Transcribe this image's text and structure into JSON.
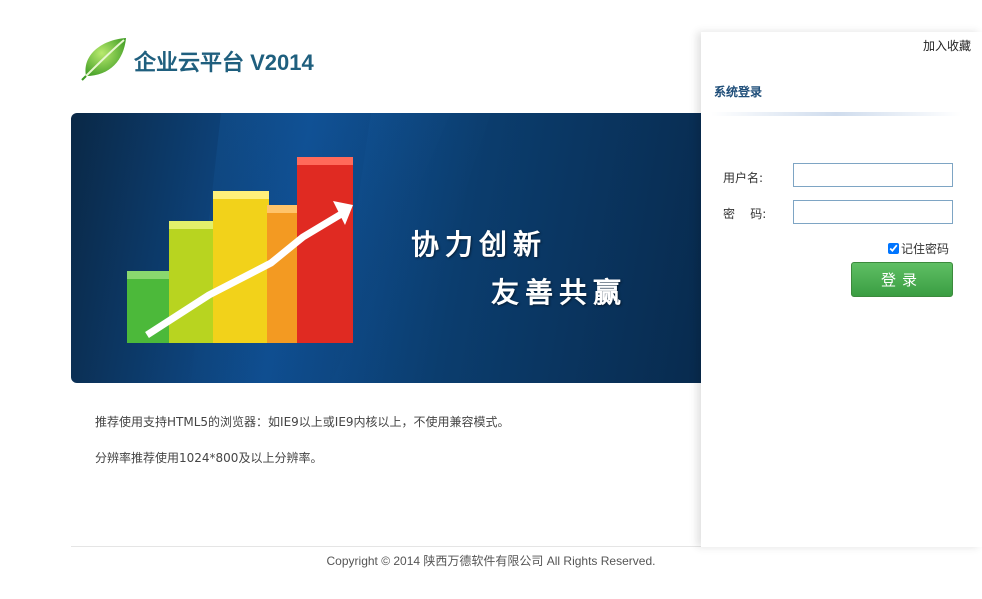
{
  "header": {
    "title": "企业云平台 V2014"
  },
  "banner": {
    "slogan_line1": "协力创新",
    "slogan_line2": "友善共赢"
  },
  "tips": {
    "browser": "推荐使用支持HTML5的浏览器：如IE9以上或IE9内核以上，不使用兼容模式。",
    "resolution": "分辨率推荐使用1024*800及以上分辨率。"
  },
  "login": {
    "add_favorite": "加入收藏",
    "heading": "系统登录",
    "username_label": "用户名:",
    "password_label": "密    码:",
    "username_value": "",
    "password_value": "",
    "remember_label": "记住密码",
    "remember_checked": true,
    "submit_label": "登录"
  },
  "footer": {
    "copyright": "Copyright © 2014 陕西万德软件有限公司 All Rights Reserved."
  },
  "colors": {
    "title": "#1f5f7e",
    "login_heading": "#1f4e79",
    "button": "#3a9d42"
  }
}
